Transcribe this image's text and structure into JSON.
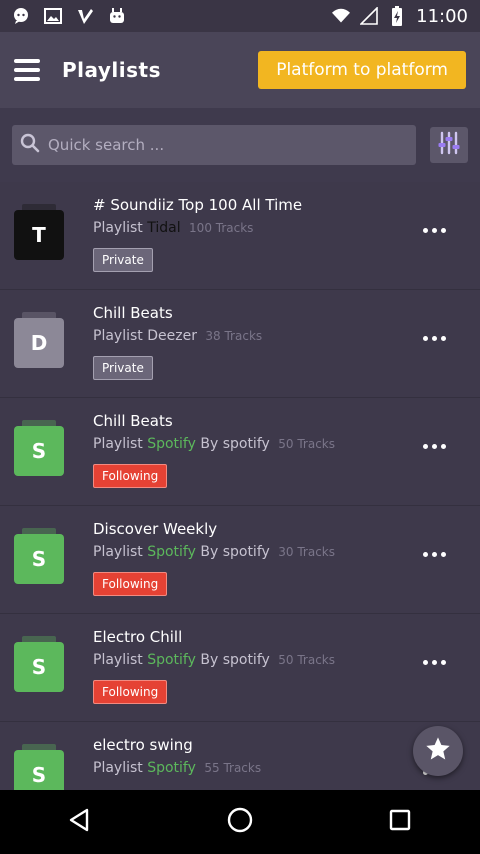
{
  "status_bar": {
    "time": "11:00"
  },
  "app_bar": {
    "title": "Playlists",
    "cta_label": "Platform to platform"
  },
  "search": {
    "placeholder": "Quick search ..."
  },
  "playlists": [
    {
      "avatar": "T",
      "avatar_color": "#111111",
      "title": "# Soundiiz Top 100 All Time",
      "type": "Playlist",
      "platform": "Tidal",
      "platform_color": "#111111",
      "by": "",
      "tracks": "100 Tracks",
      "badge": "Private",
      "badge_kind": "private"
    },
    {
      "avatar": "D",
      "avatar_color": "#8c8897",
      "title": "Chill Beats",
      "type": "Playlist",
      "platform": "Deezer",
      "platform_color": "#c6c2d0",
      "by": "",
      "tracks": "38 Tracks",
      "badge": "Private",
      "badge_kind": "private"
    },
    {
      "avatar": "S",
      "avatar_color": "#5cb85c",
      "title": "Chill Beats",
      "type": "Playlist",
      "platform": "Spotify",
      "platform_color": "#5cb85c",
      "by": "By spotify",
      "tracks": "50 Tracks",
      "badge": "Following",
      "badge_kind": "following"
    },
    {
      "avatar": "S",
      "avatar_color": "#5cb85c",
      "title": "Discover Weekly",
      "type": "Playlist",
      "platform": "Spotify",
      "platform_color": "#5cb85c",
      "by": "By spotify",
      "tracks": "30 Tracks",
      "badge": "Following",
      "badge_kind": "following"
    },
    {
      "avatar": "S",
      "avatar_color": "#5cb85c",
      "title": "Electro Chill",
      "type": "Playlist",
      "platform": "Spotify",
      "platform_color": "#5cb85c",
      "by": "By spotify",
      "tracks": "50 Tracks",
      "badge": "Following",
      "badge_kind": "following"
    },
    {
      "avatar": "S",
      "avatar_color": "#5cb85c",
      "title": "electro swing",
      "type": "Playlist",
      "platform": "Spotify",
      "platform_color": "#5cb85c",
      "by": "",
      "tracks": "55 Tracks",
      "badge": "",
      "badge_kind": "private"
    }
  ],
  "icons": {
    "notification": "chat-bubble-icon",
    "gallery": "image-icon",
    "check": "check-icon",
    "android": "android-icon",
    "wifi": "wifi-icon",
    "signal": "signal-icon",
    "battery": "battery-icon",
    "menu": "hamburger-icon",
    "search": "search-icon",
    "filter": "equalizer-icon",
    "more": "more-horizontal-icon",
    "favorite": "star-icon",
    "back": "back-triangle-icon",
    "home": "home-circle-icon",
    "recents": "recents-square-icon"
  },
  "colors": {
    "accent": "#f2b621",
    "following": "#e54234",
    "spotify": "#5cb85c"
  }
}
